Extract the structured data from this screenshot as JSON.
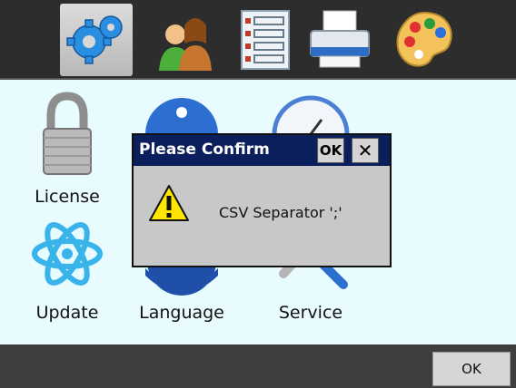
{
  "toolbar": {
    "items": [
      {
        "icon": "gear-icon",
        "selected": true
      },
      {
        "icon": "users-icon"
      },
      {
        "icon": "list-icon"
      },
      {
        "icon": "printer-icon"
      },
      {
        "icon": "palette-icon"
      }
    ]
  },
  "apps": {
    "license": "License",
    "update": "Update",
    "language": "Language",
    "service": "Service"
  },
  "dialog": {
    "title": "Please Confirm",
    "ok_label": "OK",
    "close_label": "✕",
    "message": "CSV Separator ';'"
  },
  "bottombar": {
    "ok_label": "OK"
  },
  "colors": {
    "topbar": "#2d2d2d",
    "content_bg": "#e8fbff",
    "dialog_title": "#0a1f5c",
    "dialog_body": "#c8c8c8",
    "bottombar": "#3e3e3e"
  }
}
